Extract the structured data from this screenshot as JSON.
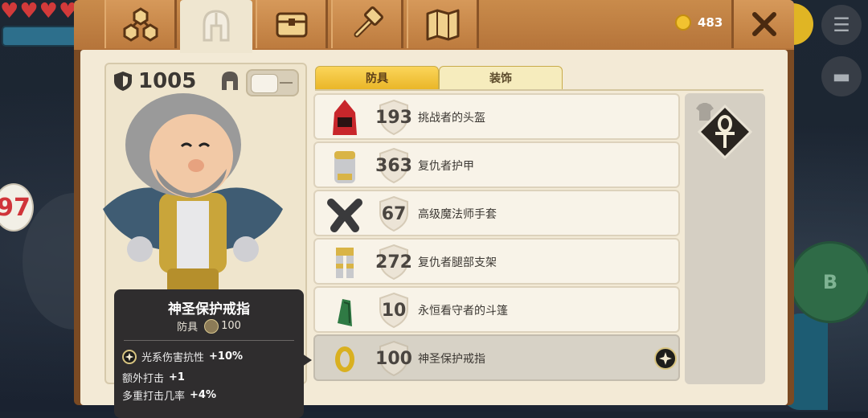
{
  "hud": {
    "badge_level": "97",
    "button_b": "B"
  },
  "header": {
    "tabs": [
      {
        "name": "tab-skills",
        "icon": "skill-tree-icon",
        "active": false
      },
      {
        "name": "tab-armor",
        "icon": "helmet-icon",
        "active": true
      },
      {
        "name": "tab-inventory",
        "icon": "chest-icon",
        "active": false
      },
      {
        "name": "tab-crafting",
        "icon": "hammer-icon",
        "active": false
      },
      {
        "name": "tab-map",
        "icon": "map-icon",
        "active": false
      }
    ],
    "coins": "483",
    "close_icon": "close-icon"
  },
  "character": {
    "armor_total": "1005"
  },
  "subtabs": {
    "armor": "防具",
    "accessories": "装饰"
  },
  "items": [
    {
      "armor": "193",
      "name": "挑战者的头盔",
      "icon": "red-hood-icon"
    },
    {
      "armor": "363",
      "name": "复仇者护甲",
      "icon": "gold-chestplate-icon"
    },
    {
      "armor": "67",
      "name": "高级魔法师手套",
      "icon": "gloves-icon"
    },
    {
      "armor": "272",
      "name": "复仇者腿部支架",
      "icon": "gold-leggings-icon"
    },
    {
      "armor": "10",
      "name": "永恒看守者的斗篷",
      "icon": "green-cloak-icon"
    },
    {
      "armor": "100",
      "name": "神圣保护戒指",
      "icon": "gold-ring-icon",
      "selected": true
    }
  ],
  "tooltip": {
    "title": "神圣保护戒指",
    "type": "防具",
    "armor": "100",
    "stat1_label": "光系伤害抗性",
    "stat1_value": "+10%",
    "stat2_label": "额外打击",
    "stat2_value": "+1",
    "stat3_label": "多重打击几率",
    "stat3_value": "+4%"
  },
  "colors": {
    "accent": "#eab628",
    "panel": "#f3ead6",
    "frame": "#b5743a"
  }
}
